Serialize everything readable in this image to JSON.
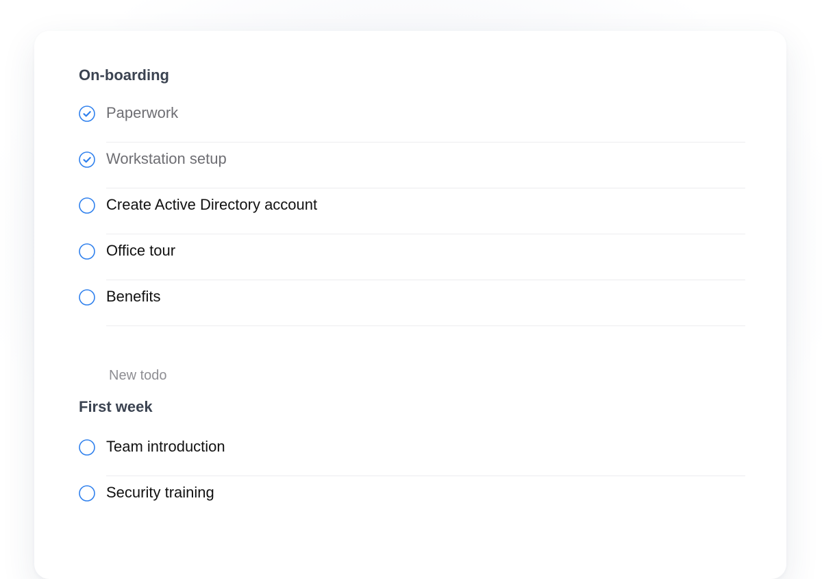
{
  "colors": {
    "accent": "#2f80ed",
    "heading": "#3b4351",
    "text": "#111111",
    "done_text": "#6e6e73",
    "placeholder": "#8e8e93",
    "divider": "#ececef"
  },
  "sections": [
    {
      "title": "On-boarding",
      "items": [
        {
          "label": "Paperwork",
          "done": true,
          "icon": "checked-circle-icon"
        },
        {
          "label": "Workstation setup",
          "done": true,
          "icon": "checked-circle-icon"
        },
        {
          "label": "Create Active Directory account",
          "done": false,
          "icon": "empty-circle-icon"
        },
        {
          "label": "Office tour",
          "done": false,
          "icon": "empty-circle-icon"
        },
        {
          "label": "Benefits",
          "done": false,
          "icon": "empty-circle-icon"
        }
      ],
      "new_todo_placeholder": "New todo"
    },
    {
      "title": "First week",
      "items": [
        {
          "label": "Team introduction",
          "done": false,
          "icon": "empty-circle-icon"
        },
        {
          "label": "Security training",
          "done": false,
          "icon": "empty-circle-icon"
        }
      ]
    }
  ]
}
